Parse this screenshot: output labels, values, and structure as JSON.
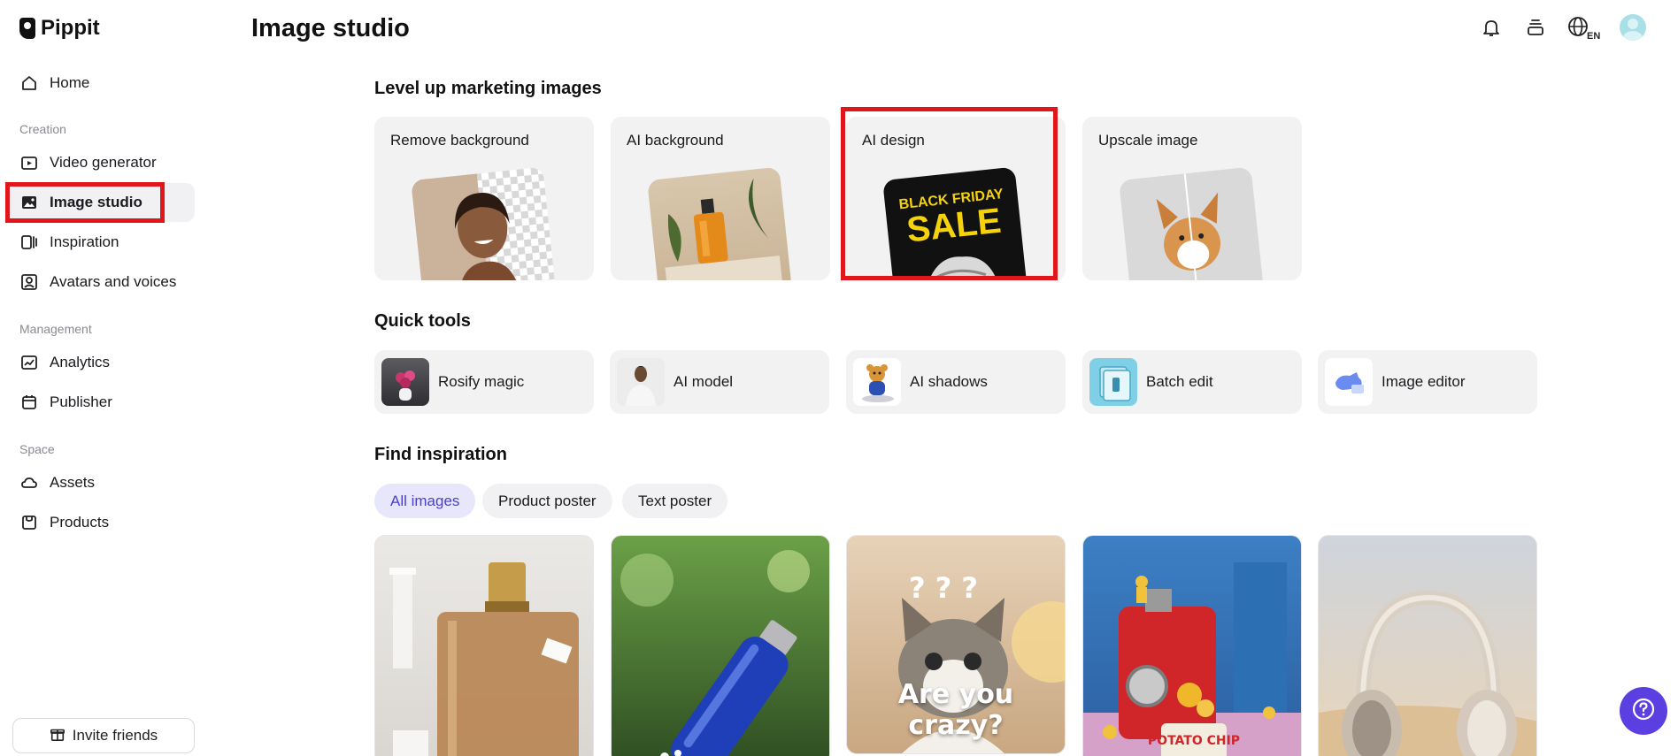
{
  "app": {
    "name": "Pippit"
  },
  "header": {
    "title": "Image studio",
    "lang_badge": "EN"
  },
  "sidebar": {
    "home": "Home",
    "creation_label": "Creation",
    "creation": [
      "Video generator",
      "Image studio",
      "Inspiration",
      "Avatars and voices"
    ],
    "management_label": "Management",
    "management": [
      "Analytics",
      "Publisher"
    ],
    "space_label": "Space",
    "space": [
      "Assets",
      "Products"
    ],
    "invite": "Invite friends"
  },
  "marketing": {
    "heading": "Level up marketing images",
    "cards": [
      "Remove background",
      "AI background",
      "AI design",
      "Upscale image"
    ],
    "sale_top": "BLACK FRIDAY",
    "sale_main": "SALE"
  },
  "quick_tools": {
    "heading": "Quick tools",
    "items": [
      "Rosify magic",
      "AI model",
      "AI shadows",
      "Batch edit",
      "Image editor"
    ]
  },
  "inspiration": {
    "heading": "Find inspiration",
    "filters": [
      "All images",
      "Product poster",
      "Text poster"
    ],
    "active_filter": "All images",
    "cat_caption": "Are you crazy?",
    "chip_bag_text": "POTATO CHIP"
  },
  "colors": {
    "accent": "#5b3fe0",
    "highlight": "#e0161b",
    "active_chip_bg": "#e8e6fb"
  }
}
